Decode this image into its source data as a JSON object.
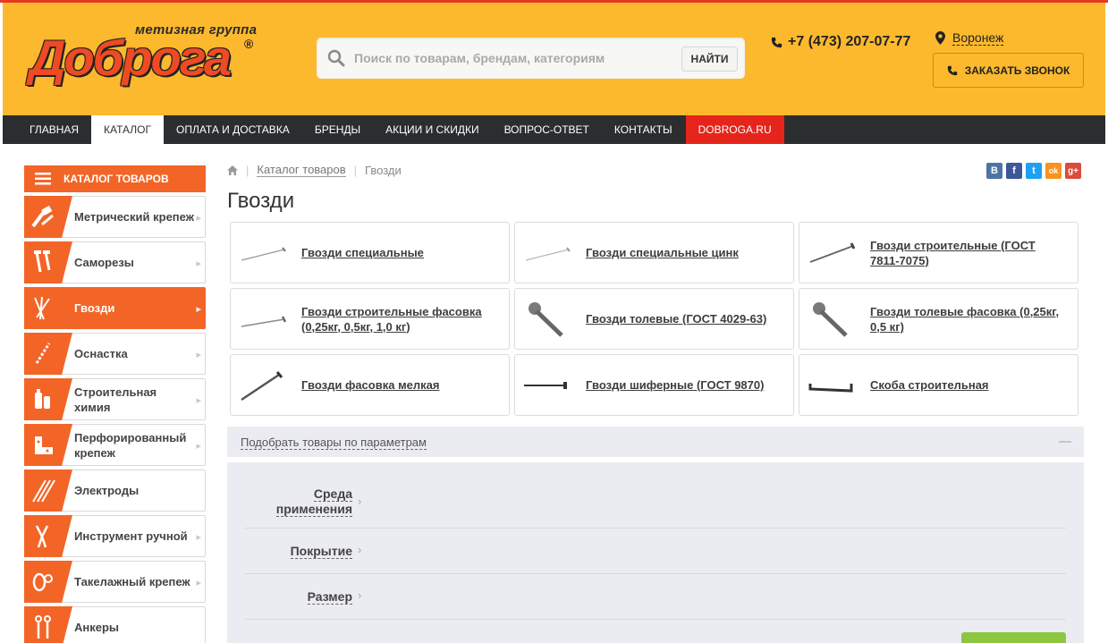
{
  "header": {
    "logo_text": "Доброга",
    "logo_subtitle": "метизная группа",
    "search_placeholder": "Поиск по товарам, брендам, категориям",
    "search_button": "НАЙТИ",
    "phone": "+7 (473) 207-07-77",
    "city": "Воронеж",
    "callback_button": "ЗАКАЗАТЬ ЗВОНОК"
  },
  "nav": {
    "items": [
      {
        "label": "Главная"
      },
      {
        "label": "Каталог"
      },
      {
        "label": "Оплата и доставка"
      },
      {
        "label": "Бренды"
      },
      {
        "label": "Акции и скидки"
      },
      {
        "label": "Вопрос-ответ"
      },
      {
        "label": "Контакты"
      },
      {
        "label": "dobroga.ru"
      }
    ]
  },
  "sidebar": {
    "header": "КАТАЛОГ ТОВАРОВ",
    "items": [
      {
        "label": "Метрический крепеж"
      },
      {
        "label": "Саморезы"
      },
      {
        "label": "Гвозди"
      },
      {
        "label": "Оснастка"
      },
      {
        "label": "Строительная химия"
      },
      {
        "label": "Перфорированный крепеж"
      },
      {
        "label": "Электроды"
      },
      {
        "label": "Инструмент ручной"
      },
      {
        "label": "Такелажный крепеж"
      },
      {
        "label": "Анкеры"
      }
    ]
  },
  "breadcrumb": {
    "catalog": "Каталог товаров",
    "current": "Гвозди"
  },
  "social": [
    "В",
    "f",
    "t",
    "ok",
    "g+"
  ],
  "page_title": "Гвозди",
  "products": [
    {
      "label": "Гвозди специальные"
    },
    {
      "label": "Гвозди специальные цинк"
    },
    {
      "label": "Гвозди строительные (ГОСТ 7811-7075)"
    },
    {
      "label": "Гвозди строительные фасовка (0,25кг, 0,5кг, 1,0 кг)"
    },
    {
      "label": "Гвозди толевые (ГОСТ 4029-63)"
    },
    {
      "label": "Гвозди толевые фасовка (0,25кг, 0,5 кг)"
    },
    {
      "label": "Гвозди фасовка мелкая"
    },
    {
      "label": "Гвозди шиферные (ГОСТ 9870)"
    },
    {
      "label": "Скоба строительная"
    }
  ],
  "filter": {
    "toggle_label": "Подобрать товары по параметрам",
    "params": [
      {
        "label": "Среда применения"
      },
      {
        "label": "Покрытие"
      },
      {
        "label": "Размер"
      }
    ]
  },
  "colors": {
    "header_bg": "#fdb92d",
    "accent": "#f26527",
    "nav_bg": "#2b2d2f",
    "nav_red": "#e5251b",
    "filter_bg": "#ebebf2",
    "show_button": "#8dc63f"
  }
}
